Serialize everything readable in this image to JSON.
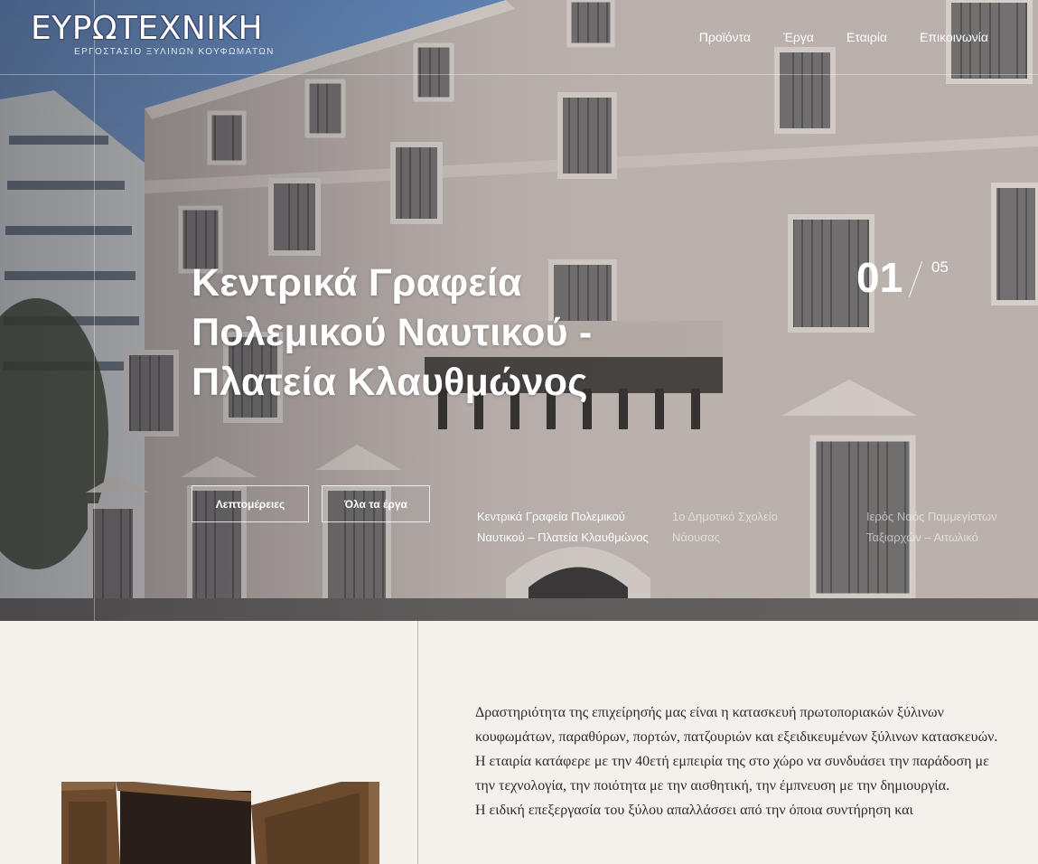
{
  "brand": {
    "title": "ΕΥΡΩΤΕΧΝΙΚΗ",
    "subtitle": "ΕΡΓΟΣΤΑΣΙΟ ΞΥΛΙΝΩΝ ΚΟΥΦΩΜΑΤΩΝ"
  },
  "nav": {
    "items": [
      {
        "label": "Προϊόντα"
      },
      {
        "label": "Έργα"
      },
      {
        "label": "Εταιρία"
      },
      {
        "label": "Επικοινωνία"
      }
    ]
  },
  "hero": {
    "title": "Κεντρικά Γραφεία Πολεμικού Ναυτικού - Πλατεία Κλαυθμώνος",
    "counter_current": "01",
    "counter_total": "05",
    "details_button": "Λεπτομέρειες",
    "all_projects_button": "Όλα τα έργα",
    "slides": [
      {
        "label": "Κεντρικά Γραφεία Πολεμικού Ναυτικού – Πλατεία Κλαυθμώνος",
        "active": true
      },
      {
        "label": "1ο Δημοτικό Σχολείο Νάουσας",
        "active": false
      },
      {
        "label": "Ιερός Ναός Παμμεγίστων Ταξιαρχών – Αιτωλικό",
        "active": false
      }
    ]
  },
  "about": {
    "paragraphs": [
      "Δραστηριότητα της επιχείρησής μας είναι η κατασκευή πρωτοποριακών ξύλινων κουφωμάτων, παραθύρων, πορτών, πατζουριών και εξειδικευμένων ξύλινων κατασκευών.",
      "Η εταιρία κατάφερε με την 40ετή εμπειρία της στο χώρο να συνδυάσει την παράδοση με την τεχνολογία, την ποιότητα με την αισθητική, την έμπνευση με την δημιουργία.",
      "Η ειδική επεξεργασία του ξύλου απαλλάσσει από την όποια συντήρηση και"
    ]
  },
  "colors": {
    "page_background": "#f4f1ec",
    "hero_text": "#ffffff",
    "logo_outline": "#3b4a74",
    "body_text": "#2b2b2b"
  }
}
